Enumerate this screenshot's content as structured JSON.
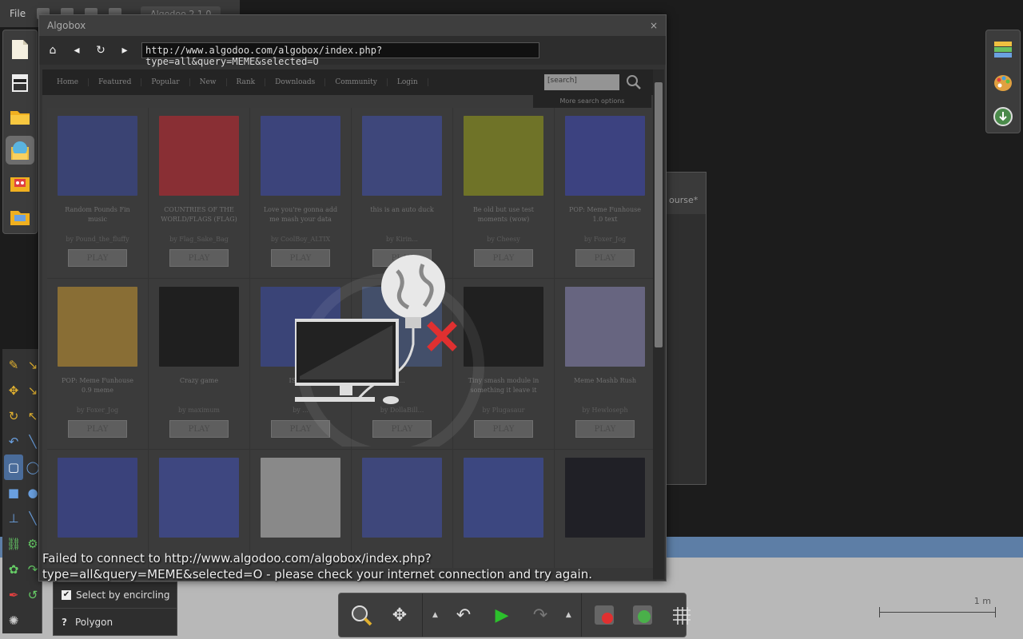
{
  "menubar": {
    "file_label": "File",
    "scene_tab": "Algodoo 2.1.0"
  },
  "algobox": {
    "title": "Algobox",
    "url": "http://www.algodoo.com/algobox/index.php?type=all&query=MEME&selected=O",
    "nav_items": [
      "Home",
      "Featured",
      "Popular",
      "New",
      "Rank",
      "Downloads",
      "Community",
      "Login"
    ],
    "search_value": "[search]",
    "more_options": "More search options",
    "play_label": "PLAY",
    "cards": [
      {
        "title": "Random Pounds Fin music",
        "author": "by Pound_the_fluffy",
        "color": "#3a4aa0"
      },
      {
        "title": "COUNTRIES OF THE WORLD/FLAGS (FLAG)",
        "author": "by Flag_Sake_Bag",
        "color": "#c8262e"
      },
      {
        "title": "Love you're gonna add me mash your data",
        "author": "by CoolBoy_ALTIX",
        "color": "#3c4cb0"
      },
      {
        "title": "this is an auto duck",
        "author": "by Kirin...",
        "color": "#4050b0"
      },
      {
        "title": "Be old but use test moments (wow)",
        "author": "by Cheesy",
        "color": "#9aa018"
      },
      {
        "title": "POP: Meme Funhouse 1.0 text",
        "author": "by Foxer_Jog",
        "color": "#3c48b8"
      },
      {
        "title": "POP: Meme Funhouse 0.9 meme",
        "author": "by Foxer_Jog",
        "color": "#c89830"
      },
      {
        "title": "Crazy game",
        "author": "by maximum",
        "color": "#080808"
      },
      {
        "title": "IS SUS",
        "author": "by ...",
        "color": "#3a4ca8"
      },
      {
        "title": "...",
        "author": "by DollaBill...",
        "color": "#4a6090"
      },
      {
        "title": "Tiny smash module in something it leave it",
        "author": "by Plugasaur",
        "color": "#0a0a0a"
      },
      {
        "title": "Meme Mashb Rush",
        "author": "by Hewloseph",
        "color": "#8a88b8"
      },
      {
        "title": "",
        "author": "",
        "color": "#3a48b0"
      },
      {
        "title": "",
        "author": "",
        "color": "#4050b8"
      },
      {
        "title": "",
        "author": "",
        "color": "#c8c8c8"
      },
      {
        "title": "",
        "author": "",
        "color": "#4050b0"
      },
      {
        "title": "",
        "author": "",
        "color": "#3c50b8"
      },
      {
        "title": "",
        "author": "",
        "color": "#0a0a14"
      }
    ],
    "error_line1": "Failed to connect to http://www.algodoo.com/algobox/index.php?",
    "error_line2": "type=all&query=MEME&selected=O - please check your internet connection and try again."
  },
  "options": {
    "select_by_encircling": "Select by encircling",
    "polygon": "Polygon",
    "help": "?"
  },
  "bg_window": {
    "title": "ourse*"
  },
  "scale": {
    "label": "1 m"
  }
}
